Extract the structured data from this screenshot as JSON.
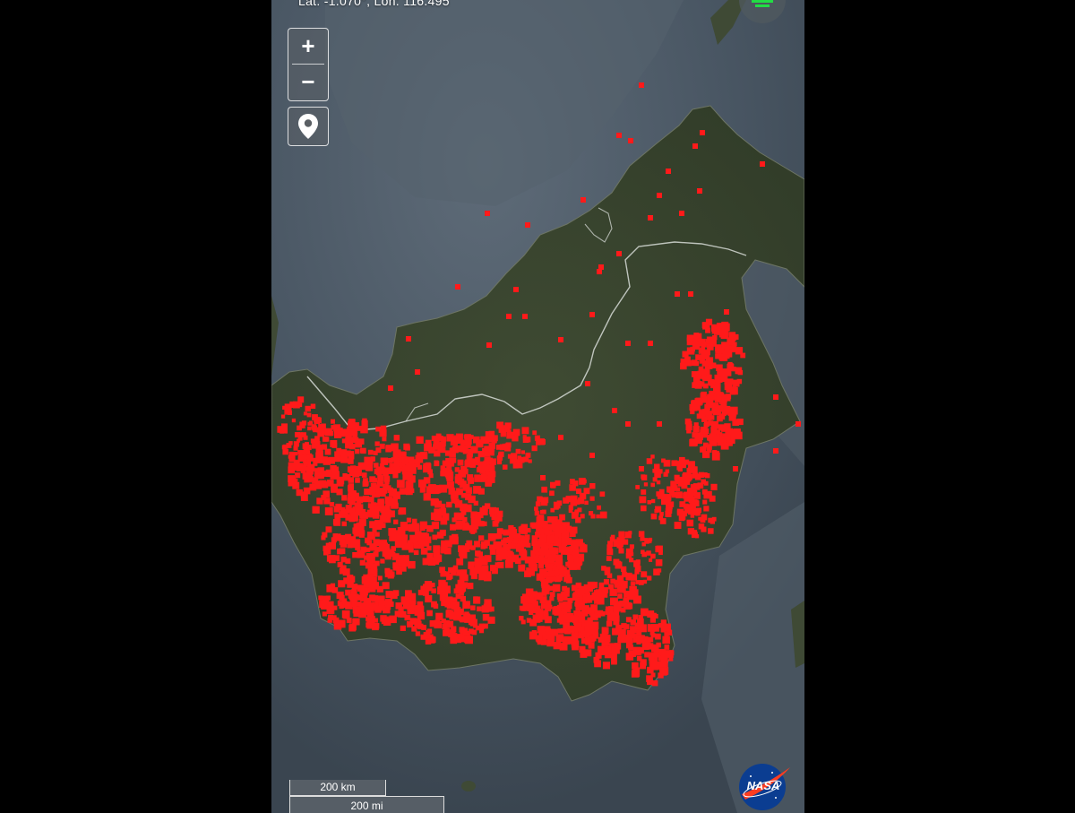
{
  "coordinates": {
    "text": "Lat: -1.070°, Lon: 116.495"
  },
  "controls": {
    "zoom_in_label": "+",
    "zoom_out_label": "−",
    "locate_icon": "map-pin-icon",
    "corner_icon": "layers-icon"
  },
  "scale_bar": {
    "km_label": "200 km",
    "mi_label": "200 mi"
  },
  "logo": {
    "text": "NASA"
  },
  "colors": {
    "ocean": "#46525e",
    "land": "#3b4631",
    "fire": "#ff1a1a",
    "border": "#d6dad6",
    "accent_green": "#22dd44",
    "logo_blue": "#0b3d91"
  }
}
